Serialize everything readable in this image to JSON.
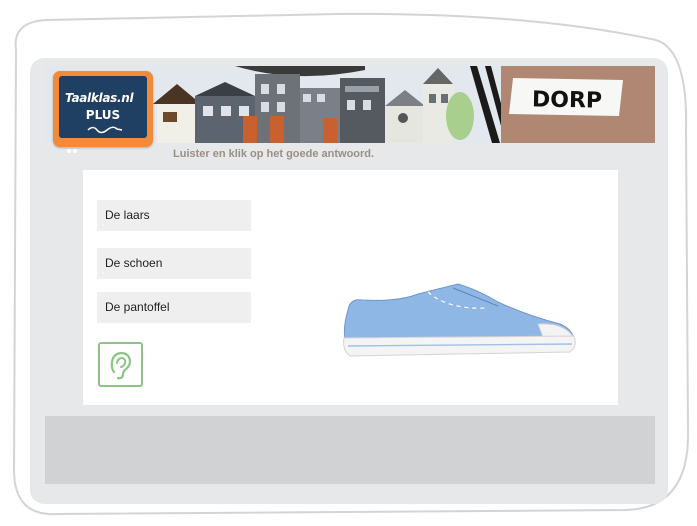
{
  "logo": {
    "line1": "Taalklas.nl",
    "line2": "PLUS"
  },
  "header": {
    "sign_text": "DORP"
  },
  "instruction": "Luister en klik op het goede antwoord.",
  "options": [
    {
      "label": "De laars"
    },
    {
      "label": "De schoen"
    },
    {
      "label": "De pantoffel"
    }
  ],
  "colors": {
    "logo_orange": "#f28a3a",
    "logo_blue": "#1f3f63",
    "ear_green": "#8ec387",
    "instruction_text": "#9a8f84",
    "shoe_blue": "#8fb7e6"
  },
  "icons": {
    "audio": "ear-icon",
    "picture": "sneaker-image"
  }
}
